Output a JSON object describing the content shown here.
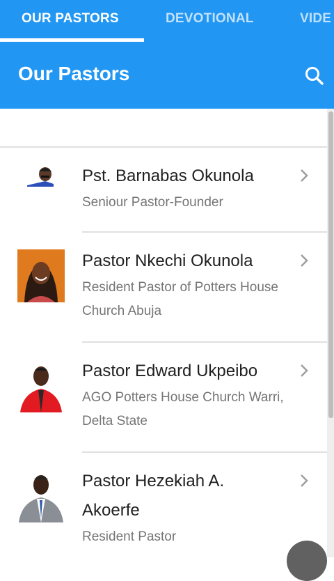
{
  "tabs": [
    {
      "label": "OUR PASTORS",
      "active": true
    },
    {
      "label": "DEVOTIONAL",
      "active": false
    },
    {
      "label": "VIDE",
      "active": false
    }
  ],
  "appbar": {
    "title": "Our Pastors",
    "search_icon": "search-icon"
  },
  "pastors": [
    {
      "name": "Pst. Barnabas Okunola",
      "subtitle": "Seniour Pastor-Founder"
    },
    {
      "name": "Pastor Nkechi Okunola",
      "subtitle_lines": [
        "Resident Pastor of Potters House",
        "Church Abuja"
      ]
    },
    {
      "name": "Pastor Edward Ukpeibo",
      "subtitle_lines": [
        "AGO Potters House Church Warri,",
        "Delta State"
      ]
    },
    {
      "name_lines": [
        "Pastor Hezekiah A.",
        "Akoerfe"
      ],
      "subtitle": "Resident Pastor"
    }
  ],
  "colors": {
    "primary": "#2196f3",
    "text_primary": "#212121",
    "text_secondary": "#757575"
  }
}
